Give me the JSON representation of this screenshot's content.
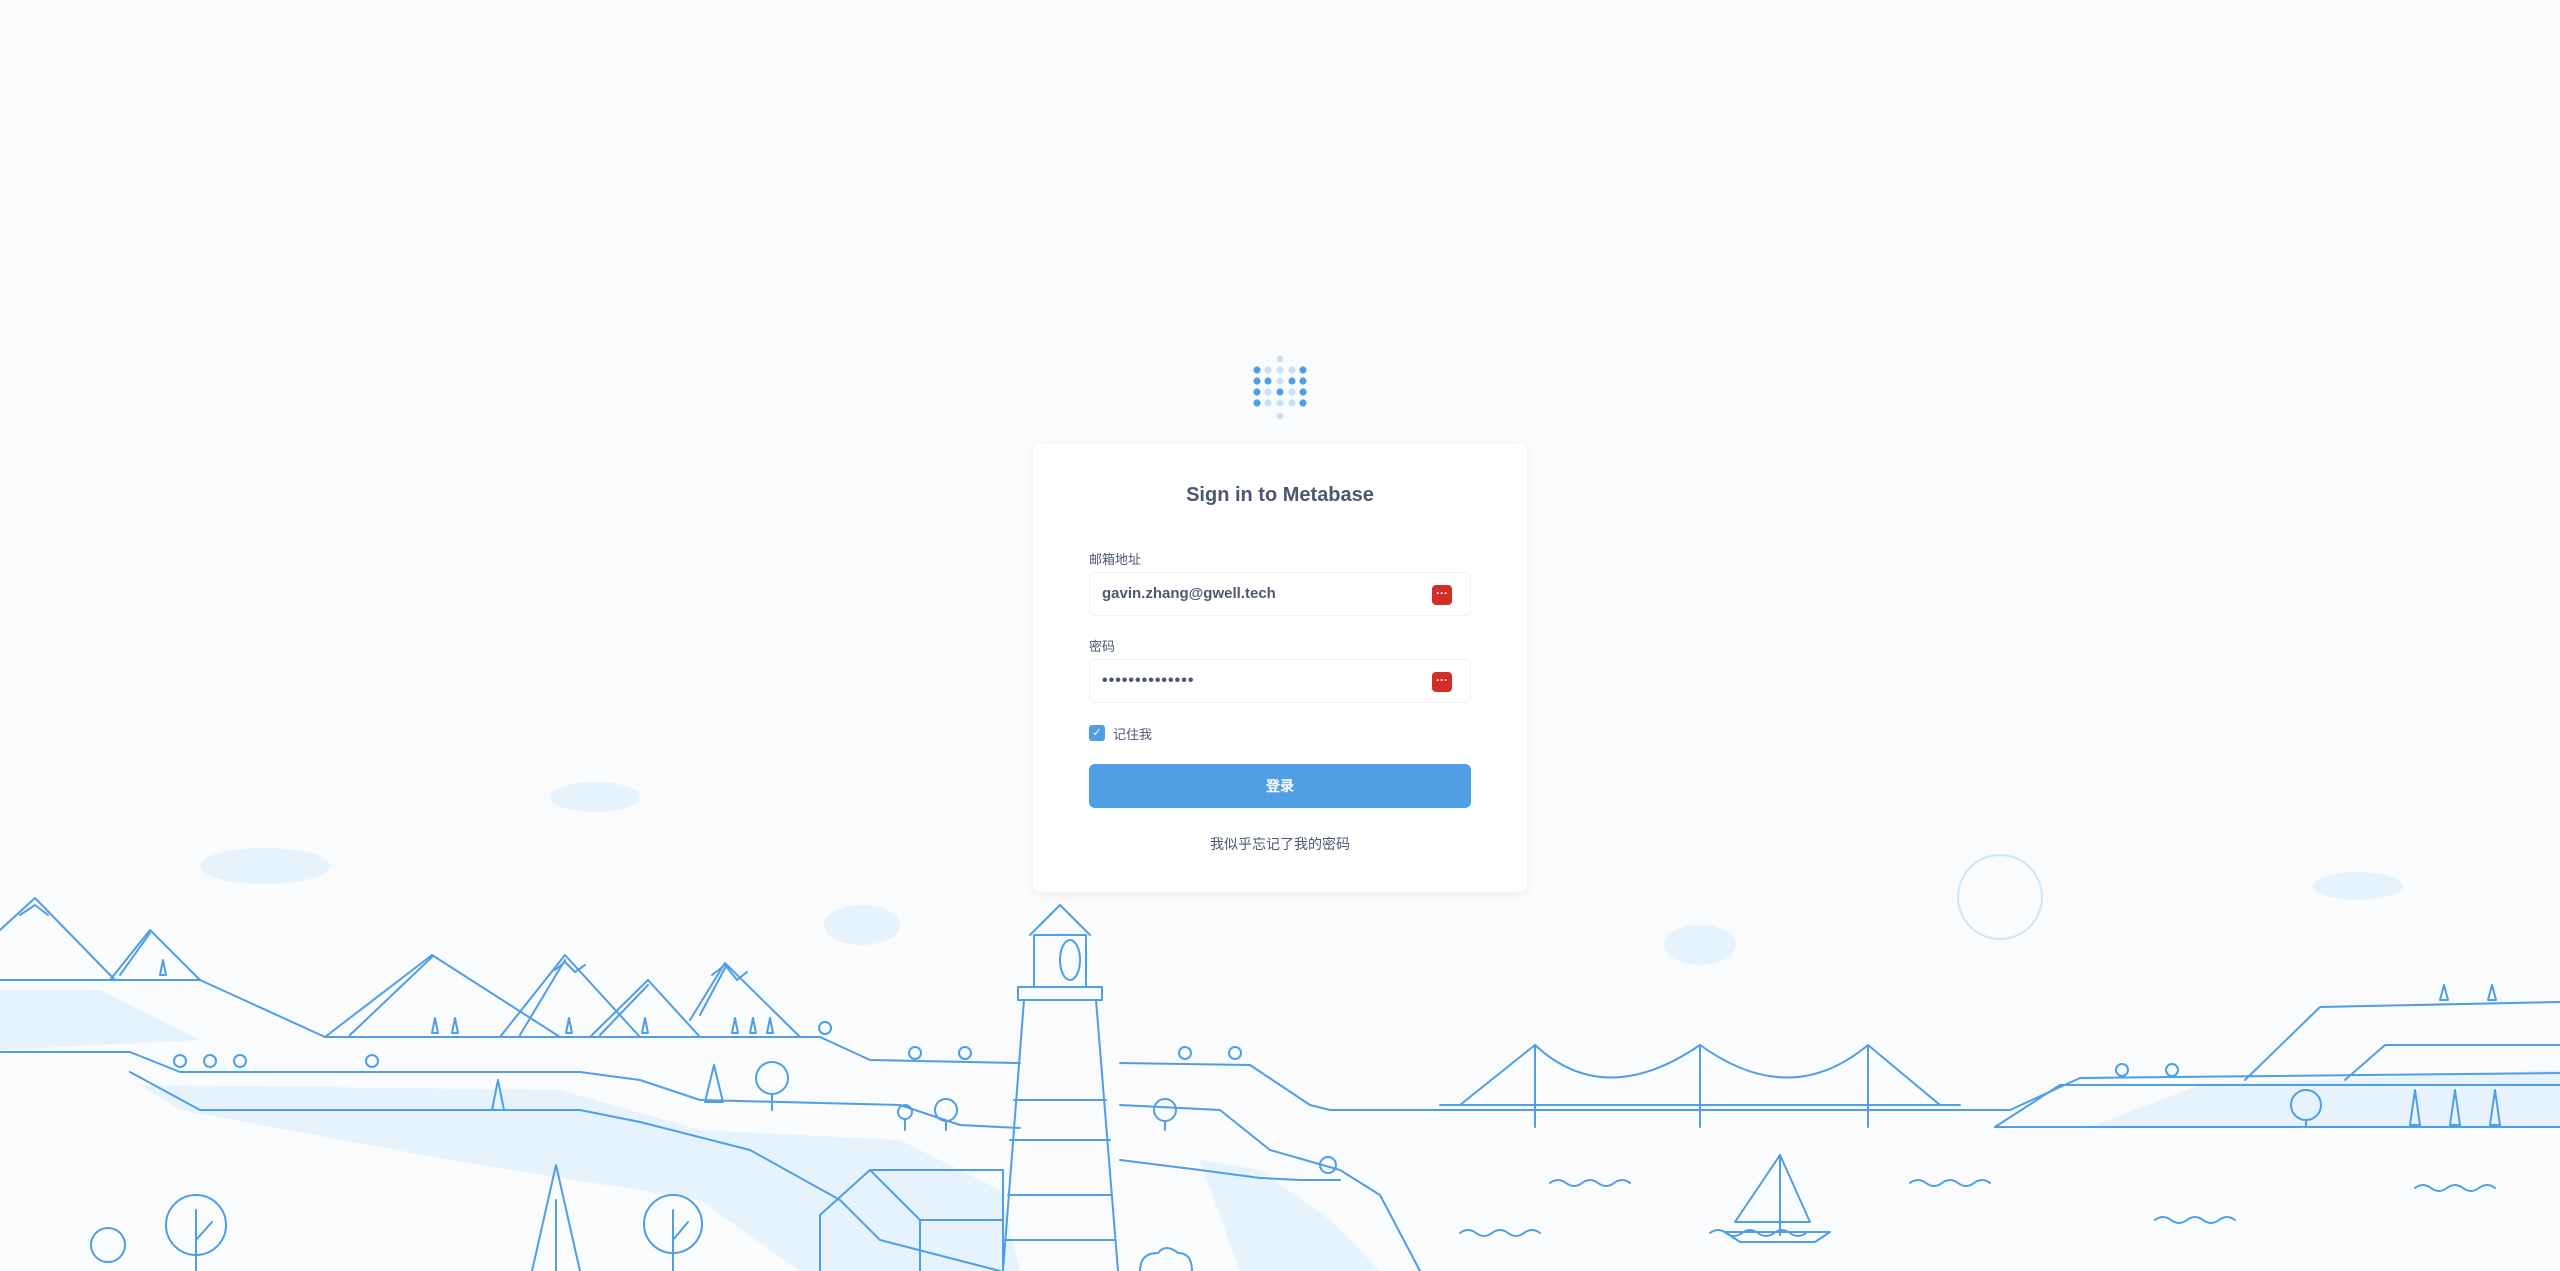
{
  "login": {
    "title": "Sign in to Metabase",
    "email_label": "邮箱地址",
    "email_value": "gavin.zhang@gwell.tech",
    "password_label": "密码",
    "password_value": "••••••••••••••",
    "remember_label": "记住我",
    "remember_checked": true,
    "submit_label": "登录",
    "forgot_label": "我似乎忘记了我的密码"
  },
  "icons": {
    "logo": "metabase-logo",
    "password_manager": "password-manager-icon",
    "checkbox": "check-icon"
  },
  "colors": {
    "accent": "#509ee3",
    "text": "#4c5773",
    "background": "#f9fbfc",
    "illustration_line": "#509ee3",
    "illustration_fill": "#e6f3fd",
    "password_manager": "#d32d27"
  }
}
